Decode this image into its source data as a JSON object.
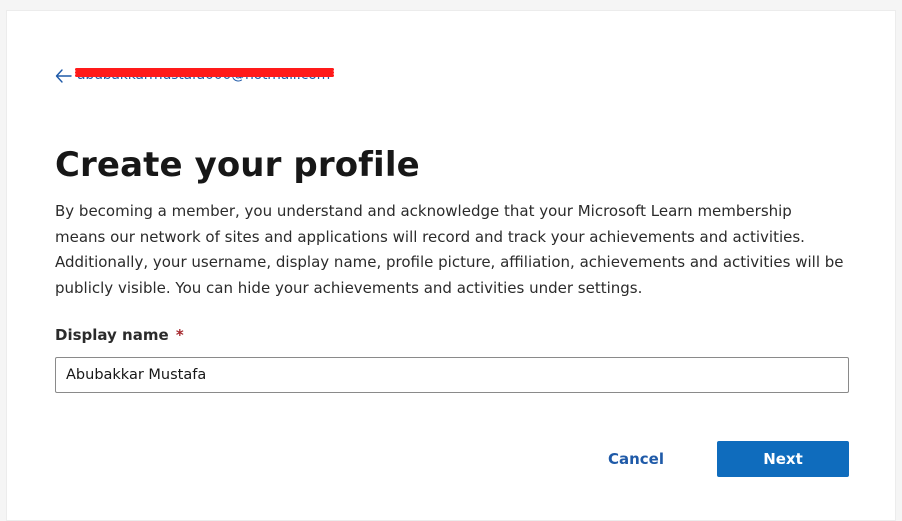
{
  "back_link": {
    "icon": "arrow-left-icon",
    "email": "abubakkarmustafa000@hotmail.com"
  },
  "page": {
    "title": "Create your profile",
    "description": "By becoming a member, you understand and acknowledge that your Microsoft Learn membership means our network of sites and applications will record and track your achievements and activities. Additionally, your username, display name, profile picture, affiliation, achievements and activities will be publicly visible. You can hide your achievements and activities under settings."
  },
  "form": {
    "display_name_label": "Display name",
    "required_marker": "*",
    "display_name_value": "Abubakkar Mustafa"
  },
  "actions": {
    "cancel_label": "Cancel",
    "next_label": "Next"
  },
  "colors": {
    "link": "#1f5aa8",
    "primary_button": "#0f6cbd",
    "redaction": "#ff1a1a",
    "required": "#a4262c"
  }
}
